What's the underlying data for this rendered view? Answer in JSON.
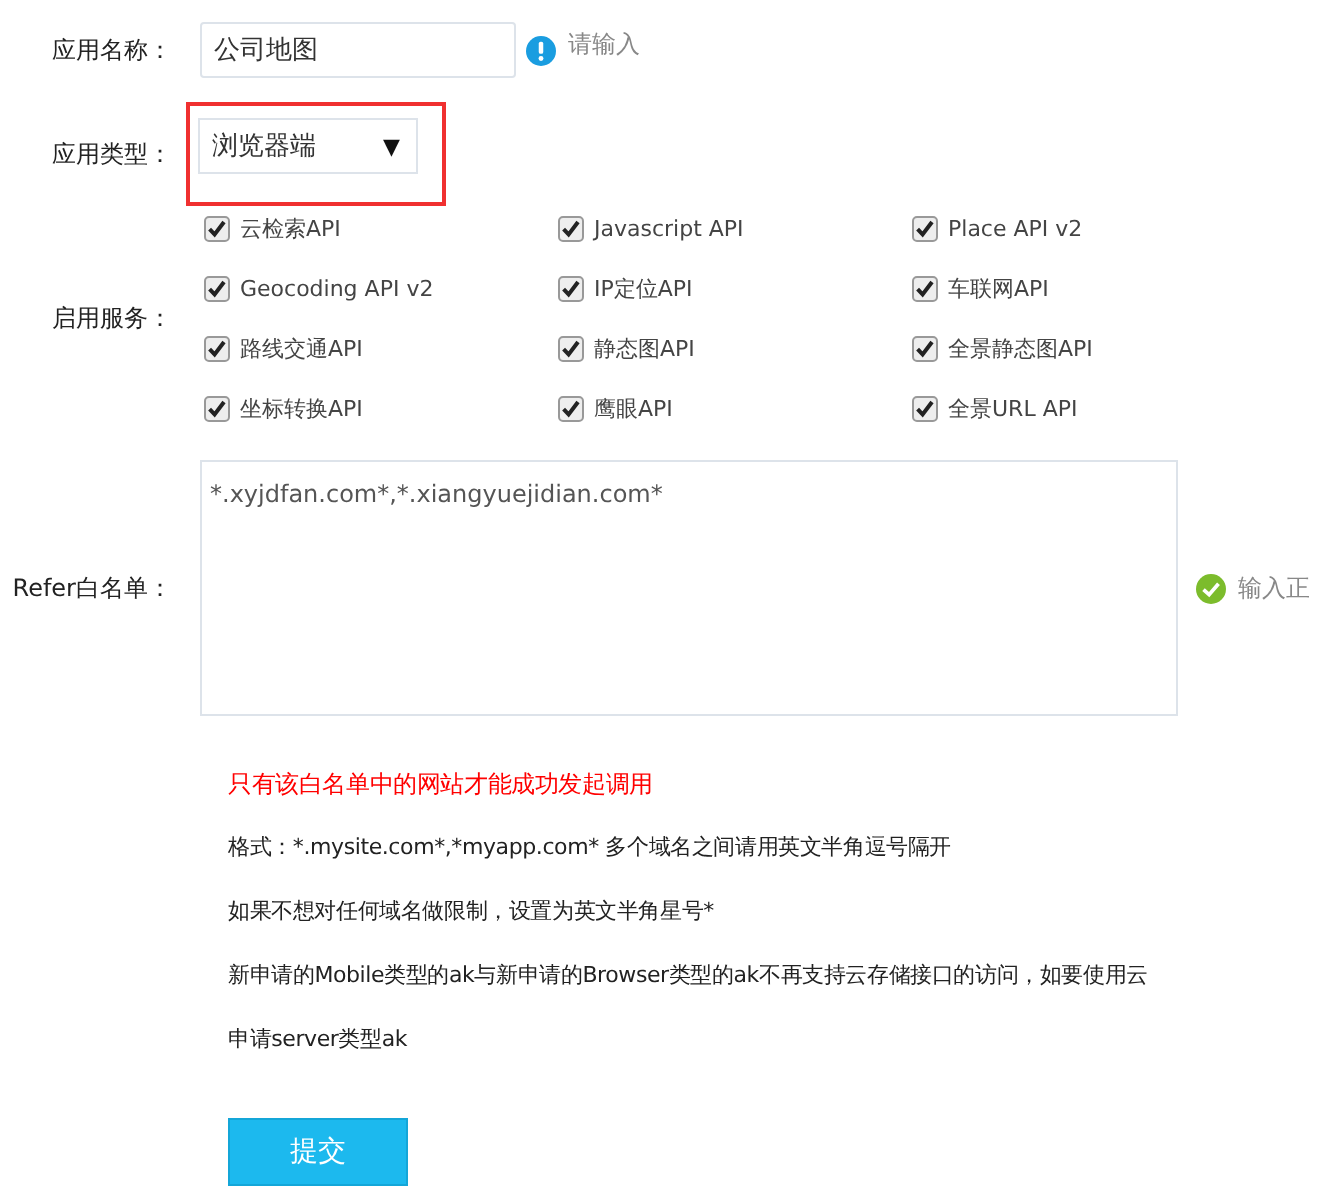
{
  "app_name": {
    "label": "应用名称：",
    "value": "公司地图",
    "hint": "请输入"
  },
  "app_type": {
    "label": "应用类型：",
    "value": "浏览器端",
    "caret": "▼",
    "highlighted": true
  },
  "services": {
    "label": "启用服务：",
    "items": [
      {
        "label": "云检索API",
        "checked": true
      },
      {
        "label": "Javascript API",
        "checked": true
      },
      {
        "label": "Place API v2",
        "checked": true
      },
      {
        "label": "Geocoding API v2",
        "checked": true
      },
      {
        "label": "IP定位API",
        "checked": true
      },
      {
        "label": "车联网API",
        "checked": true
      },
      {
        "label": "路线交通API",
        "checked": true
      },
      {
        "label": "静态图API",
        "checked": true
      },
      {
        "label": "全景静态图API",
        "checked": true
      },
      {
        "label": "坐标转换API",
        "checked": true
      },
      {
        "label": "鹰眼API",
        "checked": true
      },
      {
        "label": "全景URL API",
        "checked": true
      }
    ]
  },
  "referer": {
    "label": "Refer白名单：",
    "value": "*.xyjdfan.com*,*.xiangyuejidian.com*",
    "status": "输入正"
  },
  "notes": [
    {
      "kind": "warning",
      "text": "只有该白名单中的网站才能成功发起调用"
    },
    {
      "kind": "plain",
      "text": "格式：*.mysite.com*,*myapp.com* 多个域名之间请用英文半角逗号隔开"
    },
    {
      "kind": "plain",
      "text": "如果不想对任何域名做限制，设置为英文半角星号*"
    },
    {
      "kind": "plain",
      "text": "新申请的Mobile类型的ak与新申请的Browser类型的ak不再支持云存储接口的访问，如要使用云"
    },
    {
      "kind": "plain",
      "text": "申请server类型ak"
    }
  ],
  "submit": "提交"
}
